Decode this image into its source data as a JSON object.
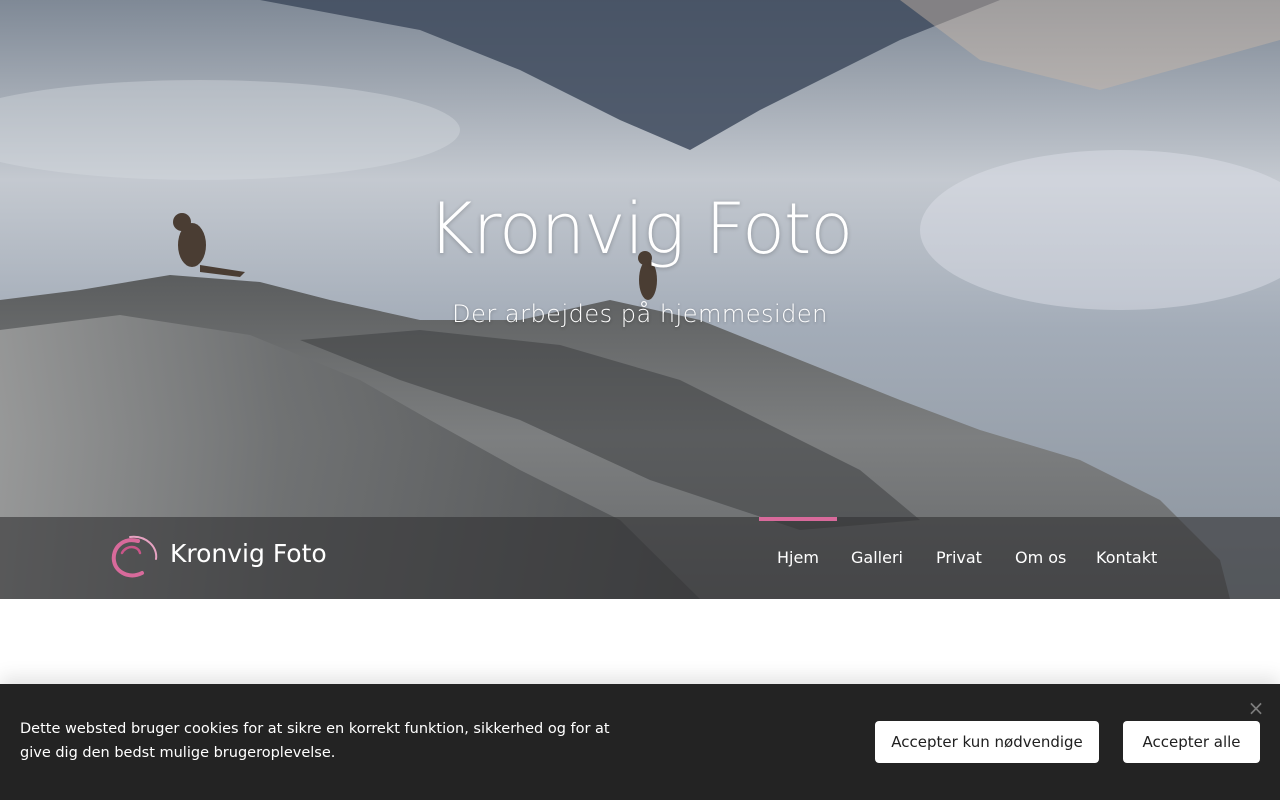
{
  "hero": {
    "title": "Kronvig Foto",
    "subtitle": "Der arbejdes på hjemmesiden"
  },
  "navbar": {
    "brand": "Kronvig Foto",
    "logo_icon": "swirl-logo-icon",
    "accent_color": "#d86a9b",
    "items": [
      {
        "label": "Hjem",
        "active": true
      },
      {
        "label": "Galleri",
        "active": false
      },
      {
        "label": "Privat",
        "active": false
      },
      {
        "label": "Om os",
        "active": false
      },
      {
        "label": "Kontakt",
        "active": false
      }
    ]
  },
  "cookie_banner": {
    "text": "Dette websted bruger cookies for at sikre en korrekt funktion, sikkerhed og for at give dig den bedst mulige brugeroplevelse.",
    "close_icon": "close-icon",
    "close_glyph": "×",
    "accept_necessary_label": "Accepter kun nødvendige",
    "accept_all_label": "Accepter alle"
  }
}
